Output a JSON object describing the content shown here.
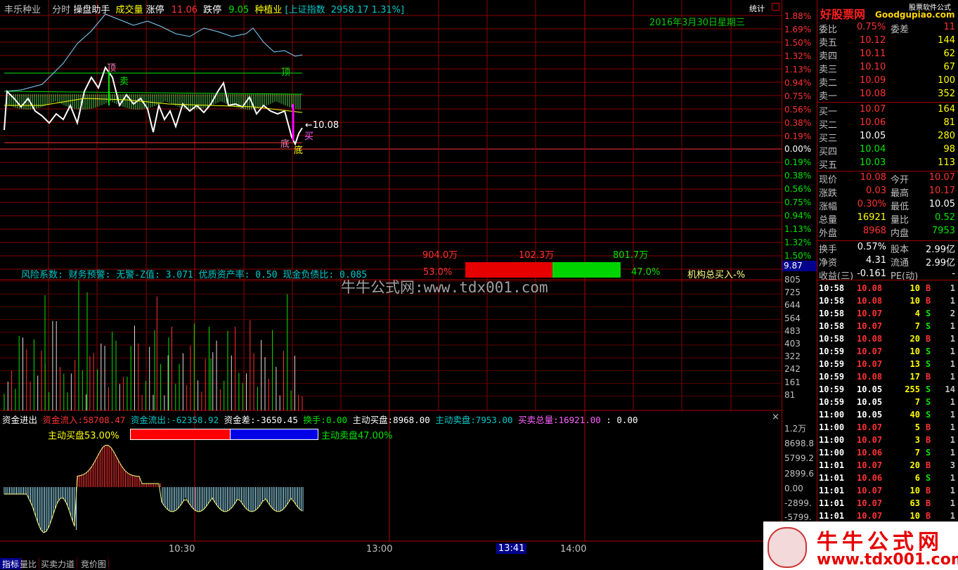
{
  "header": {
    "stock_name": "丰乐种业",
    "mode": "分时",
    "assistant": "操盘助手",
    "volume": "成交量",
    "limit_up_label": "涨停",
    "limit_up_value": "11.06",
    "limit_down_label": "跌停",
    "limit_down_value": "9.05",
    "sector": "种植业",
    "index_text": "[上证指数",
    "index_value": "2958.17",
    "index_change": "1.31%]",
    "stats": "统计",
    "date": "2016年3月30日星期三"
  },
  "brand": {
    "logo": "好股票网",
    "logo_sub": "Goodgupiao.com",
    "site": "股票软件公式"
  },
  "price_axis": {
    "up": [
      "1.88%",
      "1.69%",
      "1.50%",
      "1.32%",
      "1.13%",
      "0.94%",
      "0.75%",
      "0.56%",
      "0.38%",
      "0.19%"
    ],
    "zero": "0.00%",
    "down": [
      "0.19%",
      "0.38%",
      "0.56%",
      "0.75%",
      "0.94%",
      "1.13%",
      "1.32%",
      "1.50%"
    ],
    "price_box": "9.87"
  },
  "annotations": {
    "top1": "顶",
    "top2": "顶",
    "sell": "卖",
    "bottom1": "底",
    "bottom2": "底",
    "buy": "买",
    "price_mark": "←10.08"
  },
  "bar": {
    "left_value": "904.0万",
    "mid_value": "102.3万",
    "right_value": "801.7万",
    "left_pct": "53.0%",
    "right_pct": "47.0%"
  },
  "risk_line": "风险系数: 财务预警: 无警-Z值: 3.071 优质资产率: 0.50 现金负债比: 0.085",
  "institution": "机构总买入-%",
  "watermark": "牛牛公式网:www.tdx001.com",
  "volume_axis": [
    "805",
    "725",
    "644",
    "564",
    "483",
    "403",
    "322",
    "242",
    "161",
    "81"
  ],
  "fund_panel": {
    "title": "资金进出",
    "inflow_label": "资金流入:",
    "inflow": "58708.47",
    "outflow_label": "资金流出:",
    "outflow": "-62358.92",
    "diff_label": "资金差:",
    "diff": "-3650.45",
    "turnover_label": "换手:",
    "turnover": "0.00",
    "buy_label": "主动买盘:",
    "buy": "8968.00",
    "sell_label": "主动卖盘:",
    "sell": "7953.00",
    "total_label": "买卖总量:",
    "total": "16921.00",
    "tail": ": 0.00",
    "buy_pct_text": "主动买盘53.00%",
    "sell_pct_text": "主动卖盘47.00%",
    "close": "×",
    "buy_fraction": 0.53
  },
  "fund_axis": [
    "1.2万",
    "8698.8",
    "5799.2",
    "2899.6",
    "0.00",
    "-2899.",
    "-5799."
  ],
  "time_axis": [
    "10:30",
    "13:00",
    "13:41",
    "14:00"
  ],
  "tabs": [
    "指标",
    "量比",
    "买卖力道",
    "竞价图"
  ],
  "order_book": {
    "top": {
      "label1": "委比",
      "value1": "0.75%",
      "label2": "委差",
      "value2": "11"
    },
    "asks": [
      {
        "label": "卖五",
        "price": "10.12",
        "vol": "144"
      },
      {
        "label": "卖四",
        "price": "10.11",
        "vol": "62"
      },
      {
        "label": "卖三",
        "price": "10.10",
        "vol": "67"
      },
      {
        "label": "卖二",
        "price": "10.09",
        "vol": "100"
      },
      {
        "label": "卖一",
        "price": "10.08",
        "vol": "352"
      }
    ],
    "bids": [
      {
        "label": "买一",
        "price": "10.07",
        "vol": "164"
      },
      {
        "label": "买二",
        "price": "10.06",
        "vol": "81"
      },
      {
        "label": "买三",
        "price": "10.05",
        "vol": "280"
      },
      {
        "label": "买四",
        "price": "10.04",
        "vol": "98"
      },
      {
        "label": "买五",
        "price": "10.03",
        "vol": "113"
      }
    ]
  },
  "quote": [
    {
      "l1": "现价",
      "v1": "10.08",
      "l2": "今开",
      "v2": "10.07"
    },
    {
      "l1": "涨跌",
      "v1": "0.03",
      "l2": "最高",
      "v2": "10.17"
    },
    {
      "l1": "涨幅",
      "v1": "0.30%",
      "l2": "最低",
      "v2": "10.05"
    },
    {
      "l1": "总量",
      "v1": "16921",
      "l2": "量比",
      "v2": "0.52"
    },
    {
      "l1": "外盘",
      "v1": "8968",
      "l2": "内盘",
      "v2": "7953"
    },
    {
      "l1": "换手",
      "v1": "0.57%",
      "l2": "股本",
      "v2": "2.99亿"
    },
    {
      "l1": "净资",
      "v1": "4.31",
      "l2": "流通",
      "v2": "2.99亿"
    },
    {
      "l1": "收益(三)",
      "v1": "-0.161",
      "l2": "PE(动)",
      "v2": "-"
    }
  ],
  "trades": [
    {
      "t": "10:58",
      "p": "10.08",
      "v": "10",
      "s": "B",
      "n": "1"
    },
    {
      "t": "10:58",
      "p": "10.08",
      "v": "10",
      "s": "B",
      "n": "1"
    },
    {
      "t": "10:58",
      "p": "10.07",
      "v": "4",
      "s": "S",
      "n": "2"
    },
    {
      "t": "10:58",
      "p": "10.07",
      "v": "7",
      "s": "S",
      "n": "1"
    },
    {
      "t": "10:58",
      "p": "10.08",
      "v": "20",
      "s": "B",
      "n": "1"
    },
    {
      "t": "10:59",
      "p": "10.07",
      "v": "10",
      "s": "S",
      "n": "1"
    },
    {
      "t": "10:59",
      "p": "10.07",
      "v": "13",
      "s": "S",
      "n": "1"
    },
    {
      "t": "10:59",
      "p": "10.08",
      "v": "17",
      "s": "B",
      "n": "1"
    },
    {
      "t": "10:59",
      "p": "10.05",
      "v": "255",
      "s": "S",
      "n": "14"
    },
    {
      "t": "10:59",
      "p": "10.05",
      "v": "7",
      "s": "S",
      "n": "1"
    },
    {
      "t": "11:00",
      "p": "10.05",
      "v": "40",
      "s": "S",
      "n": "1"
    },
    {
      "t": "11:00",
      "p": "10.07",
      "v": "5",
      "s": "B",
      "n": "1"
    },
    {
      "t": "11:00",
      "p": "10.07",
      "v": "3",
      "s": "B",
      "n": "1"
    },
    {
      "t": "11:00",
      "p": "10.06",
      "v": "7",
      "s": "S",
      "n": "1"
    },
    {
      "t": "11:01",
      "p": "10.07",
      "v": "20",
      "s": "B",
      "n": "3"
    },
    {
      "t": "11:01",
      "p": "10.06",
      "v": "6",
      "s": "S",
      "n": "1"
    },
    {
      "t": "11:01",
      "p": "10.07",
      "v": "10",
      "s": "B",
      "n": "1"
    },
    {
      "t": "11:01",
      "p": "10.07",
      "v": "63",
      "s": "B",
      "n": "1"
    },
    {
      "t": "11:01",
      "p": "10.07",
      "v": "10",
      "s": "B",
      "n": "1"
    }
  ],
  "footer_brand": {
    "name": "牛牛公式网",
    "url": "www.tdx001.com"
  },
  "colors": {
    "up": "#ff3232",
    "down": "#00e600",
    "white": "#ffffff",
    "yellow": "#ffff00",
    "cyan": "#00c8c8",
    "grid": "#a00000"
  }
}
